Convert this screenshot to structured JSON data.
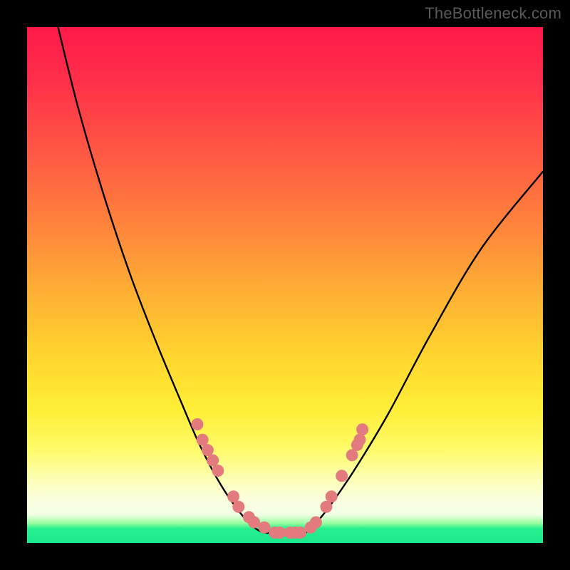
{
  "watermark": "TheBottleneck.com",
  "colors": {
    "frame": "#000000",
    "curve": "#000000",
    "marker_fill": "#e27a7e",
    "marker_stroke": "#d86a6e"
  },
  "chart_data": {
    "type": "line",
    "title": "",
    "xlabel": "",
    "ylabel": "",
    "xlim": [
      0,
      100
    ],
    "ylim": [
      0,
      100
    ],
    "note": "No axis ticks or numeric labels are present; values are relative estimates in 0–100 space read from curve position against the gradient background.",
    "series": [
      {
        "name": "left-branch",
        "x": [
          6,
          10,
          15,
          20,
          25,
          30,
          33,
          36,
          39,
          42,
          44,
          46,
          48
        ],
        "y": [
          100,
          84,
          67,
          52,
          39,
          27,
          20,
          14,
          9,
          5,
          3,
          2,
          2
        ]
      },
      {
        "name": "valley",
        "x": [
          48,
          50,
          52,
          54
        ],
        "y": [
          2,
          2,
          2,
          2
        ]
      },
      {
        "name": "right-branch",
        "x": [
          54,
          57,
          60,
          64,
          70,
          78,
          88,
          100
        ],
        "y": [
          2,
          5,
          9,
          15,
          25,
          40,
          57,
          72
        ]
      }
    ],
    "markers": {
      "name": "highlighted-points",
      "note": "Salmon-colored dots clustered near the curve minimum on both branches.",
      "points": [
        {
          "x": 33,
          "y": 23
        },
        {
          "x": 34,
          "y": 20
        },
        {
          "x": 35,
          "y": 18
        },
        {
          "x": 36,
          "y": 16
        },
        {
          "x": 37,
          "y": 14
        },
        {
          "x": 40,
          "y": 9
        },
        {
          "x": 41,
          "y": 7
        },
        {
          "x": 43,
          "y": 5
        },
        {
          "x": 44,
          "y": 4
        },
        {
          "x": 46,
          "y": 3
        },
        {
          "x": 48,
          "y": 2
        },
        {
          "x": 49,
          "y": 2
        },
        {
          "x": 51,
          "y": 2
        },
        {
          "x": 52,
          "y": 2
        },
        {
          "x": 53,
          "y": 2
        },
        {
          "x": 55,
          "y": 3
        },
        {
          "x": 56,
          "y": 4
        },
        {
          "x": 58,
          "y": 7
        },
        {
          "x": 59,
          "y": 9
        },
        {
          "x": 61,
          "y": 13
        },
        {
          "x": 63,
          "y": 17
        },
        {
          "x": 64,
          "y": 19
        },
        {
          "x": 64.5,
          "y": 20
        },
        {
          "x": 65,
          "y": 22
        }
      ]
    }
  }
}
